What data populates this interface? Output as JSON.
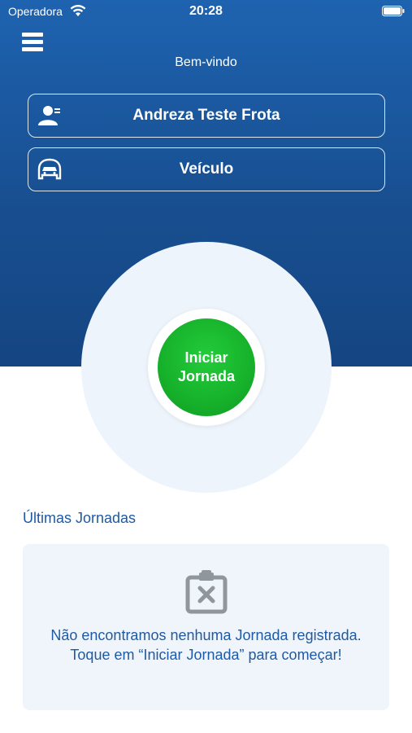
{
  "status_bar": {
    "carrier": "Operadora",
    "time": "20:28"
  },
  "header": {
    "welcome": "Bem-vindo",
    "user_button_label": "Andreza Teste Frota",
    "vehicle_button_label": "Veículo"
  },
  "main": {
    "start_button_label": "Iniciar Jornada"
  },
  "recent": {
    "title": "Últimas Jornadas",
    "empty_message": "Não encontramos nenhuma Jornada registrada. Toque em “Iniciar Jornada” para começar!"
  },
  "colors": {
    "primary": "#1e5aa3",
    "start_green": "#16b12b",
    "card_bg": "#f0f5fc"
  },
  "icons": {
    "menu": "hamburger-icon",
    "user": "user-card-icon",
    "vehicle": "car-front-icon",
    "empty": "clipboard-x-icon"
  }
}
